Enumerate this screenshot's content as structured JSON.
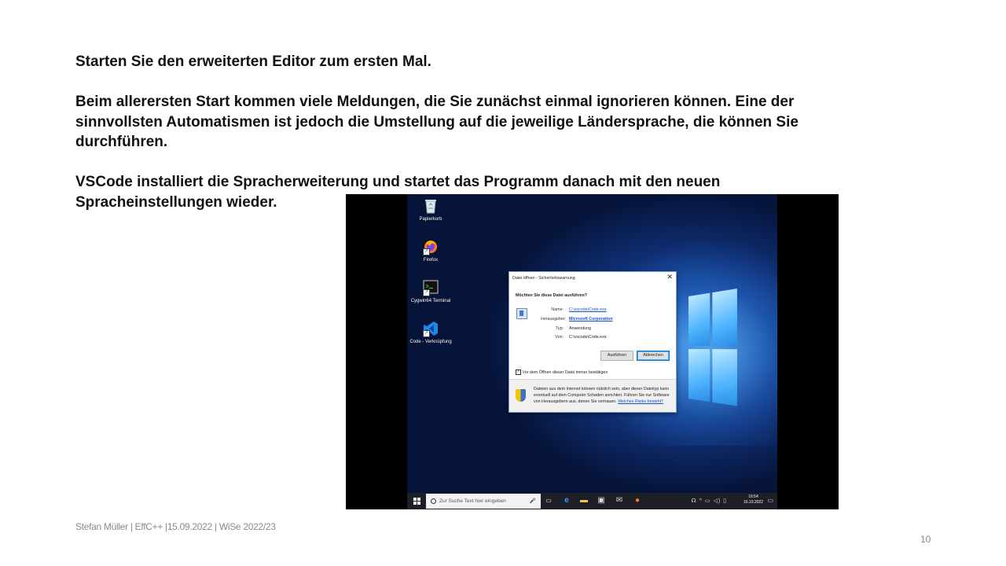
{
  "slide": {
    "para1": "Starten Sie den erweiterten Editor zum ersten Mal.",
    "para2_line1": "Beim allerersten Start kommen viele Meldungen, die Sie zunächst einmal ignorieren können. Eine der",
    "para2_line2": "sinnvollsten Automatismen ist jedoch die Umstellung auf die jeweilige Ländersprache, die können Sie",
    "para2_line3": "durchführen.",
    "para3_line1": "VSCode installiert die Spracherweiterung und startet das Programm danach mit den neuen",
    "para3_line2": "Spracheinstellungen wieder.",
    "footer": "Stefan Müller | EffC++ |15.09.2022 | WiSe 2022/23",
    "page_number": "10"
  },
  "desktop": {
    "icons": [
      {
        "label": "Papierkorb",
        "icon": "recycle-bin-icon"
      },
      {
        "label": "Firefox",
        "icon": "firefox-icon"
      },
      {
        "label": "Cygwin64 Terminal",
        "icon": "terminal-icon"
      },
      {
        "label": "Code - Verknüpfung",
        "icon": "vscode-icon"
      }
    ]
  },
  "dialog": {
    "title": "Datei öffnen - Sicherheitswarnung",
    "close": "✕",
    "question": "Möchten Sie diese Datei ausführen?",
    "name_label": "Name:",
    "name_value": "C:\\vscode\\Code.exe",
    "publisher_label": "Herausgeber:",
    "publisher_value": "Microsoft Corporation",
    "type_label": "Typ:",
    "type_value": "Anwendung",
    "from_label": "Von:",
    "from_value": "C:\\vscode\\Code.exe",
    "run_button": "Ausführen",
    "cancel_button": "Abbrechen",
    "checkbox_label": "Vor dem Öffnen dieser Datei immer bestätigen",
    "checkbox_checked": true,
    "warning_text": "Dateien aus dem Internet können nützlich sein, aber dieser Dateityp kann eventuell auf dem Computer Schaden anrichten. Führen Sie nur Software von Herausgebern aus, denen Sie vertrauen.",
    "warning_link": "Welches Risiko besteht?"
  },
  "taskbar": {
    "search_placeholder": "Zur Suche Text hier eingeben",
    "time": "16:54",
    "date": "16.10.2022"
  }
}
